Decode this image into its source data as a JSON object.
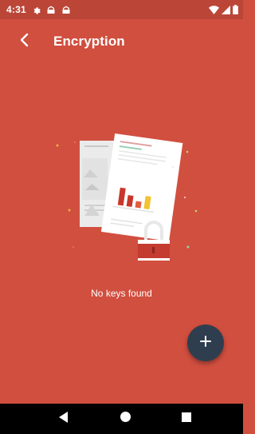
{
  "status_bar": {
    "time": "4:31",
    "icons_left": [
      "settings-icon",
      "notification-icon",
      "notification-icon"
    ],
    "icons_right": [
      "wifi-icon",
      "signal-icon",
      "battery-icon"
    ]
  },
  "app_bar": {
    "back_icon": "back-arrow-icon",
    "title": "Encryption"
  },
  "empty_state": {
    "illustration": "documents-lock-illustration",
    "message": "No keys found"
  },
  "fab": {
    "icon": "add-icon"
  },
  "nav_bar": {
    "buttons": [
      "nav-back-icon",
      "nav-home-icon",
      "nav-recents-icon"
    ]
  },
  "colors": {
    "background": "#d14f3f",
    "status_bar": "#bb4638",
    "fab": "#2f3e4e",
    "nav_bar": "#000000"
  }
}
